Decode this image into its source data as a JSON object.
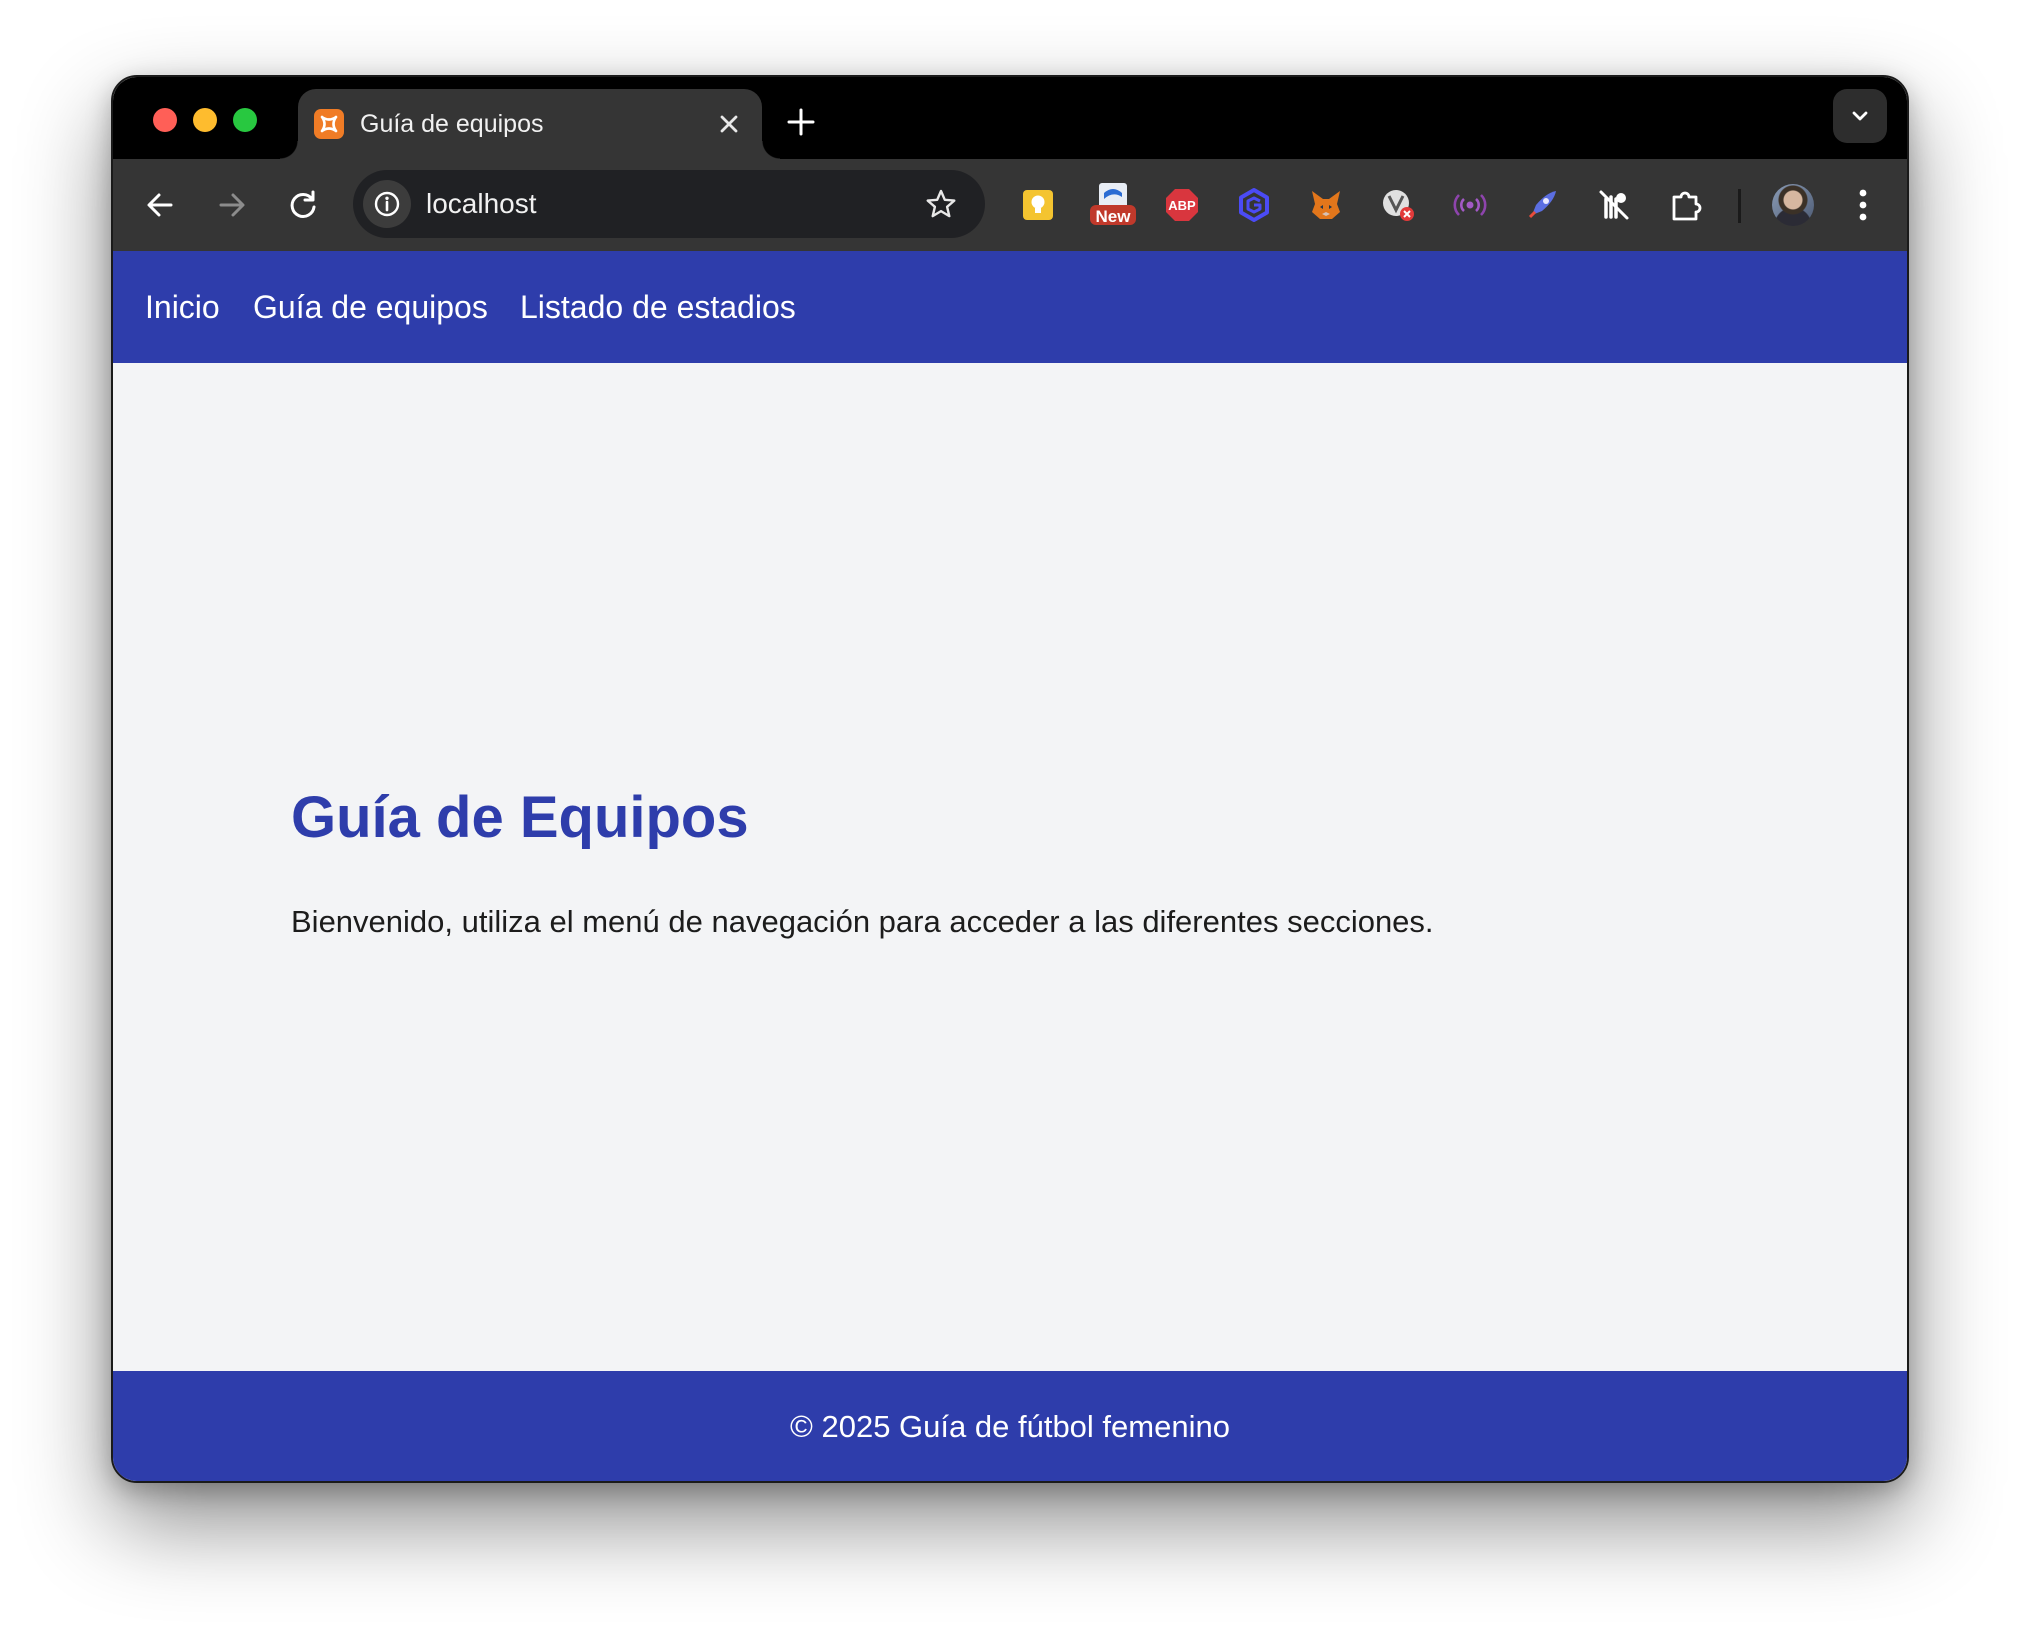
{
  "browser": {
    "tab": {
      "title": "Guía de equipos"
    },
    "address_bar": {
      "url": "localhost"
    },
    "extensions": [
      {
        "name": "lightbulb-extension-icon",
        "color": "#f4c430"
      },
      {
        "name": "new-badge-extension-icon",
        "badge": "New",
        "color": "#c0392b"
      },
      {
        "name": "adblock-plus-icon",
        "label": "ABP",
        "color": "#d9363e"
      },
      {
        "name": "hexagon-extension-icon",
        "color": "#4b4bf5"
      },
      {
        "name": "metamask-fox-icon",
        "color": "#e2761b"
      },
      {
        "name": "wappalyzer-icon",
        "color": "#e0e0e0"
      },
      {
        "name": "broadcast-extension-icon",
        "color": "#a259c6"
      },
      {
        "name": "rocket-extension-icon",
        "color": "#5b6ee1"
      },
      {
        "name": "tracker-blocker-icon",
        "color": "#ffffff"
      },
      {
        "name": "puzzle-extensions-icon",
        "color": "#ffffff"
      }
    ]
  },
  "nav": {
    "links": [
      "Inicio",
      "Guía de equipos",
      "Listado de estadios"
    ]
  },
  "main": {
    "heading": "Guía de Equipos",
    "text": "Bienvenido, utiliza el menú de navegación para acceder a las diferentes secciones."
  },
  "footer": {
    "text": "© 2025 Guía de fútbol femenino"
  },
  "colors": {
    "brand": "#2e3dab",
    "page_background": "#f3f4f6",
    "text": "#1c1c1c"
  }
}
